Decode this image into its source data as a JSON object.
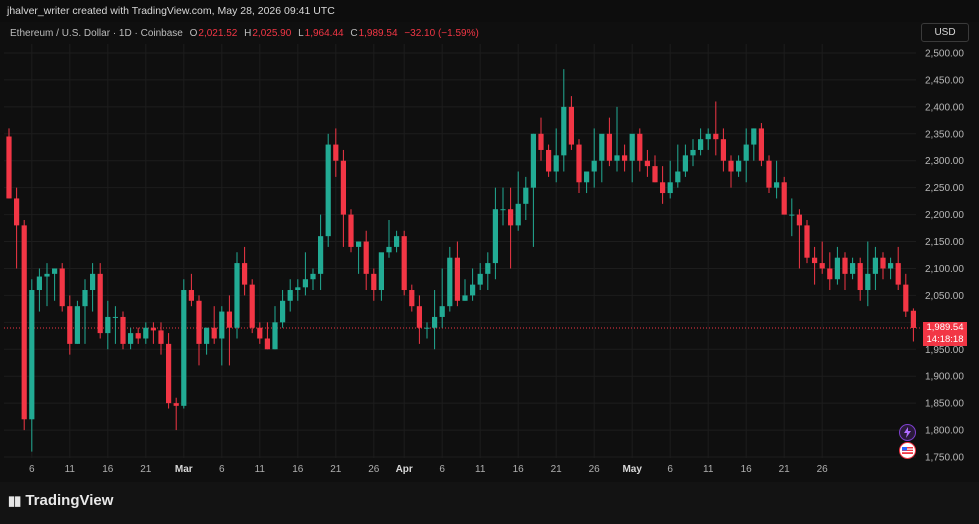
{
  "header": {
    "caption": "jhalver_writer created with TradingView.com, May 28, 2026 09:41 UTC"
  },
  "legend": {
    "symbol": "Ethereum / U.S. Dollar · 1D · Coinbase",
    "open_label": "O",
    "open": "2,021.52",
    "high_label": "H",
    "high": "2,025.90",
    "low_label": "L",
    "low": "1,964.44",
    "close_label": "C",
    "close": "1,989.54",
    "change": "−32.10 (−1.59%)"
  },
  "currency_button": "USD",
  "price_tag": {
    "price": "1,989.54",
    "countdown": "14:18:18"
  },
  "brand": {
    "name": "TradingView"
  },
  "icons": [
    "lightning-icon",
    "us-flag-icon",
    "tradingview-logo-icon"
  ],
  "colors": {
    "up": "#22ab94",
    "down": "#f23645",
    "background": "#0f0f0f",
    "text": "#c9c9c9"
  },
  "chart_data": {
    "type": "candlestick",
    "y_axis": {
      "min": 1750,
      "max": 2500,
      "ticks": [
        "2,500.00",
        "2,450.00",
        "2,400.00",
        "2,350.00",
        "2,300.00",
        "2,250.00",
        "2,200.00",
        "2,150.00",
        "2,100.00",
        "2,050.00",
        "2,000.00",
        "1,950.00",
        "1,900.00",
        "1,850.00",
        "1,800.00",
        "1,750.00"
      ],
      "tick_values": [
        2500,
        2450,
        2400,
        2350,
        2300,
        2250,
        2200,
        2150,
        2100,
        2050,
        2000,
        1950,
        1900,
        1850,
        1800,
        1750
      ]
    },
    "x_axis": {
      "labels": [
        "6",
        "11",
        "16",
        "21",
        "Mar",
        "6",
        "11",
        "16",
        "21",
        "26",
        "Apr",
        "6",
        "11",
        "16",
        "21",
        "26",
        "May",
        "6",
        "11",
        "16",
        "21",
        "26"
      ],
      "label_index": [
        3,
        8,
        13,
        18,
        23,
        28,
        33,
        38,
        43,
        48,
        52,
        57,
        62,
        67,
        72,
        77,
        82,
        87,
        92,
        97,
        102,
        107
      ]
    },
    "grid": true,
    "current_price_line": 1989.54,
    "candles": [
      [
        2345,
        2360,
        2230,
        2230
      ],
      [
        2230,
        2250,
        2100,
        2180
      ],
      [
        2180,
        2190,
        1800,
        1820
      ],
      [
        1820,
        2080,
        1760,
        2060
      ],
      [
        2060,
        2100,
        2020,
        2085
      ],
      [
        2085,
        2110,
        2030,
        2090
      ],
      [
        2090,
        2100,
        2040,
        2100
      ],
      [
        2100,
        2110,
        2020,
        2030
      ],
      [
        2030,
        2050,
        1940,
        1960
      ],
      [
        1960,
        2040,
        1960,
        2030
      ],
      [
        2030,
        2080,
        1960,
        2060
      ],
      [
        2060,
        2110,
        2020,
        2090
      ],
      [
        2090,
        2110,
        1970,
        1980
      ],
      [
        1980,
        2040,
        1950,
        2010
      ],
      [
        2010,
        2030,
        1960,
        2010
      ],
      [
        2010,
        2020,
        1950,
        1960
      ],
      [
        1960,
        1990,
        1950,
        1980
      ],
      [
        1980,
        1990,
        1960,
        1970
      ],
      [
        1970,
        2000,
        1960,
        1990
      ],
      [
        1990,
        2000,
        1960,
        1985
      ],
      [
        1985,
        2000,
        1940,
        1960
      ],
      [
        1960,
        1980,
        1840,
        1850
      ],
      [
        1850,
        1860,
        1800,
        1845
      ],
      [
        1845,
        2080,
        1840,
        2060
      ],
      [
        2060,
        2090,
        2030,
        2040
      ],
      [
        2040,
        2050,
        1920,
        1960
      ],
      [
        1960,
        1990,
        1940,
        1990
      ],
      [
        1990,
        2030,
        1960,
        1970
      ],
      [
        1970,
        2030,
        1920,
        2020
      ],
      [
        2020,
        2050,
        1920,
        1990
      ],
      [
        1990,
        2130,
        1970,
        2110
      ],
      [
        2110,
        2140,
        2050,
        2070
      ],
      [
        2070,
        2080,
        1980,
        1990
      ],
      [
        1990,
        2000,
        1960,
        1970
      ],
      [
        1970,
        2000,
        1950,
        1950
      ],
      [
        1950,
        2030,
        1950,
        2000
      ],
      [
        2000,
        2060,
        1990,
        2040
      ],
      [
        2040,
        2080,
        2020,
        2060
      ],
      [
        2060,
        2080,
        2040,
        2065
      ],
      [
        2065,
        2130,
        2050,
        2080
      ],
      [
        2080,
        2100,
        2060,
        2090
      ],
      [
        2090,
        2200,
        2060,
        2160
      ],
      [
        2160,
        2350,
        2140,
        2330
      ],
      [
        2330,
        2360,
        2270,
        2300
      ],
      [
        2300,
        2320,
        2140,
        2200
      ],
      [
        2200,
        2210,
        2130,
        2140
      ],
      [
        2140,
        2150,
        2090,
        2150
      ],
      [
        2150,
        2170,
        2060,
        2090
      ],
      [
        2090,
        2100,
        2040,
        2060
      ],
      [
        2060,
        2120,
        2040,
        2130
      ],
      [
        2130,
        2190,
        2120,
        2140
      ],
      [
        2140,
        2170,
        2130,
        2160
      ],
      [
        2160,
        2170,
        2050,
        2060
      ],
      [
        2060,
        2070,
        2020,
        2030
      ],
      [
        2030,
        2050,
        1960,
        1990
      ],
      [
        1990,
        2000,
        1970,
        1990
      ],
      [
        1990,
        2060,
        1950,
        2010
      ],
      [
        2010,
        2100,
        1990,
        2030
      ],
      [
        2030,
        2140,
        2020,
        2120
      ],
      [
        2120,
        2150,
        2030,
        2040
      ],
      [
        2040,
        2080,
        2040,
        2050
      ],
      [
        2050,
        2100,
        2040,
        2070
      ],
      [
        2070,
        2110,
        2060,
        2090
      ],
      [
        2090,
        2130,
        2060,
        2110
      ],
      [
        2110,
        2250,
        2080,
        2210
      ],
      [
        2210,
        2250,
        2180,
        2210
      ],
      [
        2210,
        2250,
        2100,
        2180
      ],
      [
        2180,
        2280,
        2170,
        2220
      ],
      [
        2220,
        2270,
        2190,
        2250
      ],
      [
        2250,
        2350,
        2140,
        2350
      ],
      [
        2350,
        2380,
        2300,
        2320
      ],
      [
        2320,
        2330,
        2270,
        2280
      ],
      [
        2280,
        2360,
        2260,
        2310
      ],
      [
        2310,
        2470,
        2280,
        2400
      ],
      [
        2400,
        2420,
        2320,
        2330
      ],
      [
        2330,
        2340,
        2240,
        2260
      ],
      [
        2260,
        2270,
        2240,
        2280
      ],
      [
        2280,
        2360,
        2250,
        2300
      ],
      [
        2300,
        2340,
        2260,
        2350
      ],
      [
        2350,
        2380,
        2290,
        2300
      ],
      [
        2300,
        2400,
        2280,
        2310
      ],
      [
        2310,
        2330,
        2280,
        2300
      ],
      [
        2300,
        2320,
        2260,
        2350
      ],
      [
        2350,
        2360,
        2280,
        2300
      ],
      [
        2300,
        2320,
        2270,
        2290
      ],
      [
        2290,
        2310,
        2260,
        2260
      ],
      [
        2260,
        2290,
        2220,
        2240
      ],
      [
        2240,
        2300,
        2230,
        2260
      ],
      [
        2260,
        2330,
        2250,
        2280
      ],
      [
        2280,
        2330,
        2270,
        2310
      ],
      [
        2310,
        2340,
        2290,
        2320
      ],
      [
        2320,
        2360,
        2310,
        2340
      ],
      [
        2340,
        2360,
        2320,
        2350
      ],
      [
        2350,
        2410,
        2310,
        2340
      ],
      [
        2340,
        2360,
        2280,
        2300
      ],
      [
        2300,
        2310,
        2250,
        2280
      ],
      [
        2280,
        2310,
        2270,
        2300
      ],
      [
        2300,
        2360,
        2260,
        2330
      ],
      [
        2330,
        2360,
        2300,
        2360
      ],
      [
        2360,
        2370,
        2290,
        2300
      ],
      [
        2300,
        2310,
        2240,
        2250
      ],
      [
        2250,
        2300,
        2230,
        2260
      ],
      [
        2260,
        2270,
        2200,
        2200
      ],
      [
        2200,
        2230,
        2160,
        2200
      ],
      [
        2200,
        2210,
        2100,
        2180
      ],
      [
        2180,
        2190,
        2110,
        2120
      ],
      [
        2120,
        2140,
        2070,
        2110
      ],
      [
        2110,
        2150,
        2090,
        2100
      ],
      [
        2100,
        2130,
        2060,
        2080
      ],
      [
        2080,
        2140,
        2070,
        2120
      ],
      [
        2120,
        2130,
        2060,
        2090
      ],
      [
        2090,
        2120,
        2080,
        2110
      ],
      [
        2110,
        2120,
        2040,
        2060
      ],
      [
        2060,
        2150,
        2030,
        2090
      ],
      [
        2090,
        2140,
        2060,
        2120
      ],
      [
        2120,
        2130,
        2080,
        2100
      ],
      [
        2100,
        2120,
        2080,
        2110
      ],
      [
        2110,
        2140,
        2060,
        2070
      ],
      [
        2070,
        2090,
        2010,
        2020
      ],
      [
        2021.52,
        2025.9,
        1964.44,
        1989.54
      ]
    ]
  }
}
